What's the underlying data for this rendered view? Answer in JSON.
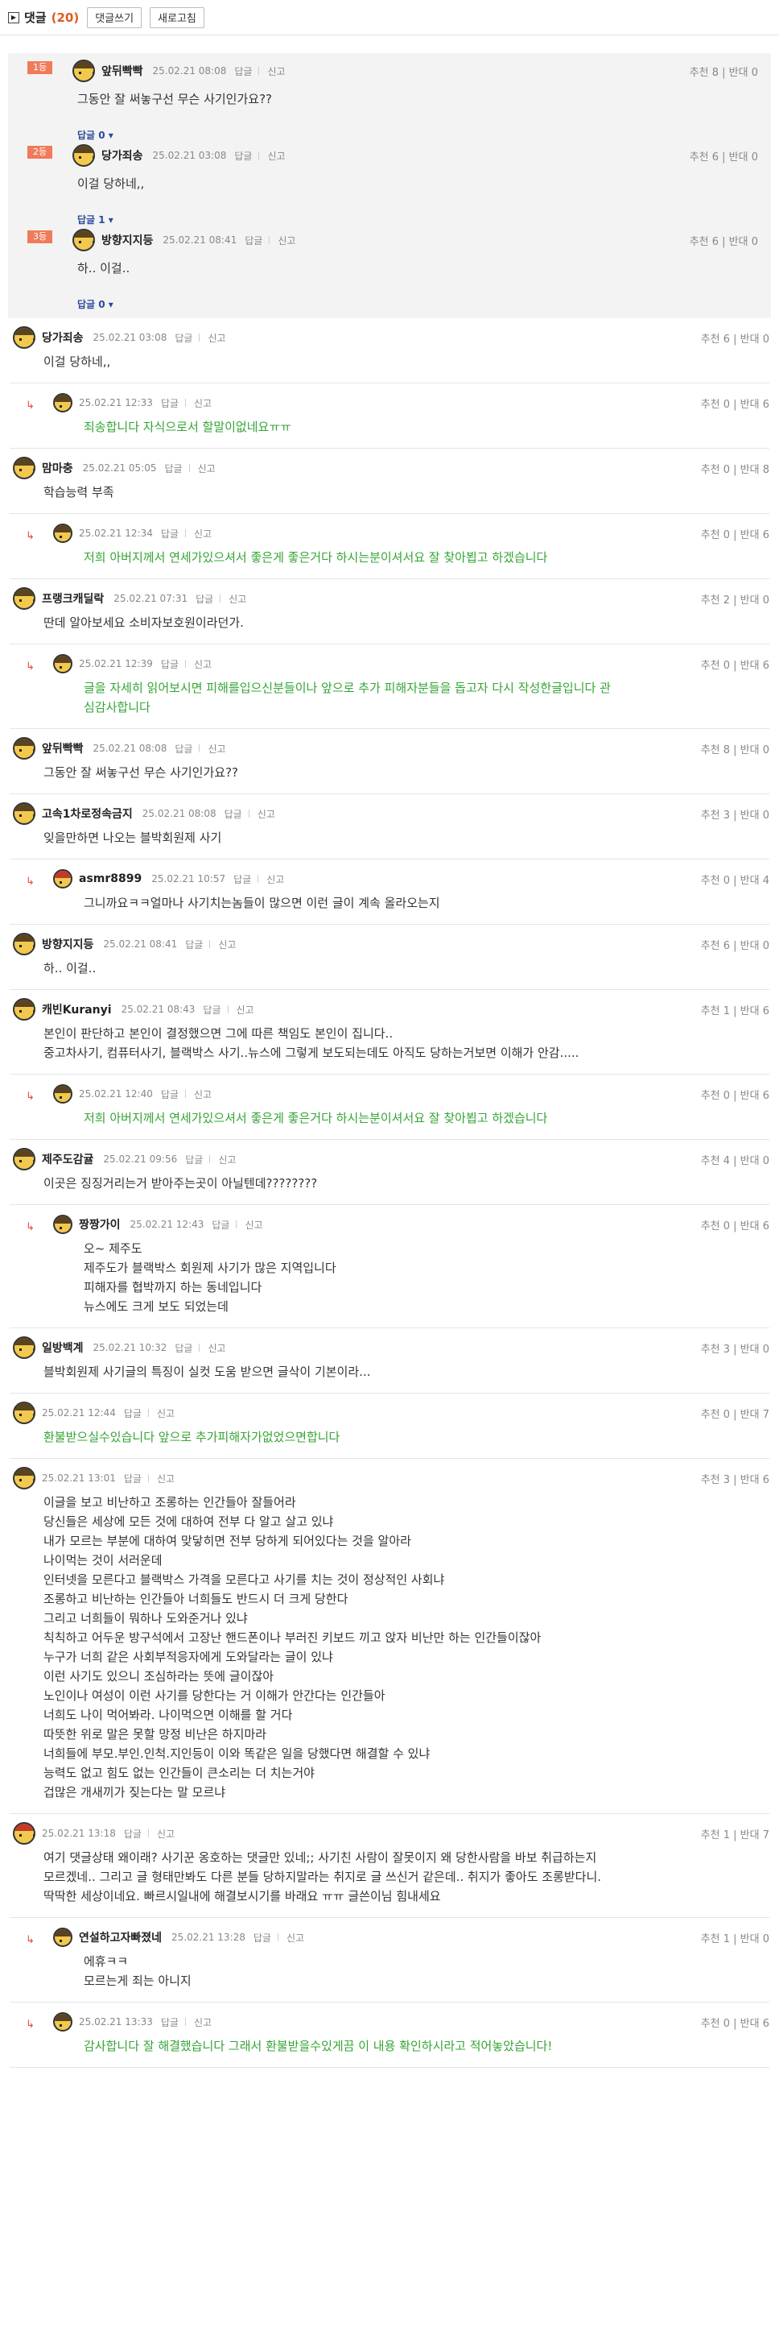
{
  "header": {
    "title": "댓글",
    "count": "(20)",
    "write_label": "댓글쓰기",
    "refresh_label": "새로고침"
  },
  "labels": {
    "reply": "답글",
    "report": "신고",
    "up": "추천",
    "down": "반대"
  },
  "best": [
    {
      "rank": "1등",
      "nick": "앞뒤빡빡",
      "date": "25.02.21 08:08",
      "text": "그동안 잘 써놓구선 무슨 사기인가요??",
      "up": "8",
      "down": "0",
      "reply_toggle": "답글 0 ▾"
    },
    {
      "rank": "2등",
      "nick": "당가죄송",
      "date": "25.02.21 03:08",
      "text": "이걸 당하네,,",
      "up": "6",
      "down": "0",
      "reply_toggle": "답글 1 ▾"
    },
    {
      "rank": "3등",
      "nick": "방향지지등",
      "date": "25.02.21 08:41",
      "text": "하.. 이걸..",
      "up": "6",
      "down": "0",
      "reply_toggle": "답글 0 ▾"
    }
  ],
  "comments": [
    {
      "reply": false,
      "nick": "당가죄송",
      "date": "25.02.21 03:08",
      "up": "6",
      "down": "0",
      "lines": [
        "이걸 당하네,,"
      ]
    },
    {
      "reply": true,
      "nick": "",
      "date": "25.02.21 12:33",
      "up": "0",
      "down": "6",
      "green": true,
      "lines": [
        "죄송합니다 자식으로서 할말이없네요ㅠㅠ"
      ]
    },
    {
      "reply": false,
      "nick": "맘마충",
      "date": "25.02.21 05:05",
      "up": "0",
      "down": "8",
      "lines": [
        "학습능력 부족"
      ]
    },
    {
      "reply": true,
      "nick": "",
      "date": "25.02.21 12:34",
      "up": "0",
      "down": "6",
      "green": true,
      "lines": [
        "저희 아버지께서 연세가있으셔서 좋은게 좋은거다 하시는분이셔서요 잘 찾아뵙고 하겠습니다"
      ]
    },
    {
      "reply": false,
      "nick": "프랭크캐딜락",
      "date": "25.02.21 07:31",
      "up": "2",
      "down": "0",
      "lines": [
        "딴데 알아보세요 소비자보호원이라던가."
      ]
    },
    {
      "reply": true,
      "nick": "",
      "date": "25.02.21 12:39",
      "up": "0",
      "down": "6",
      "green": true,
      "lines": [
        "글을 자세히 읽어보시면 피해를입으신분들이나 앞으로 추가 피해자분들을 돕고자 다시 작성한글입니다 관",
        "심감사합니다"
      ]
    },
    {
      "reply": false,
      "nick": "앞뒤빡빡",
      "date": "25.02.21 08:08",
      "up": "8",
      "down": "0",
      "lines": [
        "그동안 잘 써놓구선 무슨 사기인가요??"
      ]
    },
    {
      "reply": false,
      "nick": "고속1차로정속금지",
      "date": "25.02.21 08:08",
      "up": "3",
      "down": "0",
      "lines": [
        "잊을만하면 나오는 블박회원제 사기"
      ]
    },
    {
      "reply": true,
      "nick": "asmr8899",
      "date": "25.02.21 10:57",
      "up": "0",
      "down": "4",
      "avatar": "red",
      "lines": [
        "그니까요ㅋㅋ얼마나 사기치는놈들이 많으면 이런 글이 계속 올라오는지"
      ]
    },
    {
      "reply": false,
      "nick": "방향지지등",
      "date": "25.02.21 08:41",
      "up": "6",
      "down": "0",
      "lines": [
        "하.. 이걸.."
      ]
    },
    {
      "reply": false,
      "nick": "캐빈Kuranyi",
      "date": "25.02.21 08:43",
      "up": "1",
      "down": "6",
      "lines": [
        "본인이 판단하고 본인이 결정했으면 그에 따른 책임도 본인이 집니다..",
        "중고차사기, 컴퓨터사기, 블랙박스 사기..뉴스에 그렇게 보도되는데도 아직도 당하는거보면 이해가 안감....."
      ]
    },
    {
      "reply": true,
      "nick": "",
      "date": "25.02.21 12:40",
      "up": "0",
      "down": "6",
      "green": true,
      "lines": [
        "저희 아버지께서 연세가있으셔서 좋은게 좋은거다 하시는분이셔서요 잘 찾아뵙고 하겠습니다"
      ]
    },
    {
      "reply": false,
      "nick": "제주도감귤",
      "date": "25.02.21 09:56",
      "up": "4",
      "down": "0",
      "lines": [
        "이곳은 징징거리는거 받아주는곳이 아닐텐데????????"
      ]
    },
    {
      "reply": true,
      "nick": "짱짱가이",
      "date": "25.02.21 12:43",
      "up": "0",
      "down": "6",
      "lines": [
        "오~ 제주도",
        "제주도가 블랙박스 회원제 사기가 많은 지역입니다",
        "피해자를 협박까지 하는 동네입니다",
        "뉴스에도 크게 보도 되었는데"
      ]
    },
    {
      "reply": false,
      "nick": "일방백계",
      "date": "25.02.21 10:32",
      "up": "3",
      "down": "0",
      "lines": [
        "블박회원제 사기글의 특징이 실컷 도움 받으면 글삭이 기본이라..."
      ]
    },
    {
      "reply": false,
      "nick": "",
      "date": "25.02.21 12:44",
      "up": "0",
      "down": "7",
      "green": true,
      "lines": [
        "환불받으실수있습니다 앞으로 추가피해자가없었으면합니다"
      ]
    },
    {
      "reply": false,
      "nick": "",
      "date": "25.02.21 13:01",
      "up": "3",
      "down": "6",
      "lines": [
        "이글을 보고 비난하고 조롱하는 인간들아 잘들어라",
        "당신들은 세상에 모든 것에 대하여 전부 다 알고 살고 있냐",
        "내가 모르는 부분에 대하여 맞닿히면 전부 당하게 되어있다는 것을 알아라",
        "나이먹는 것이 서러운데",
        "인터넷을 모른다고 블랙박스 가격을 모른다고 사기를 치는 것이 정상적인 사회냐",
        "조롱하고 비난하는 인간들아 너희들도 반드시 더 크게 당한다",
        "그리고 너희들이 뭐하나 도와준거나 있냐",
        "칙칙하고 어두운 방구석에서 고장난 핸드폰이나 부러진 키보드 끼고 앉자 비난만 하는 인간들이잖아",
        "누구가 너희 같은 사회부적응자에게 도와달라는 글이 있냐",
        "이런 사기도 있으니 조심하라는 뜻에 글이잖아",
        "노인이나 여성이 이런 사기를 당한다는 거 이해가 안간다는 인간들아",
        "너희도 나이 먹어봐라. 나이먹으면 이해를 할 거다",
        "따뜻한 위로 말은 못할 망정 비난은 하지마라",
        "너희들에 부모.부인.인척.지인등이 이와 똑같은 일을 당했다면 해결할 수 있냐",
        "능력도 없고 힘도 없는 인간들이 큰소리는 더 치는거야",
        "겁많은 개새끼가 짖는다는 말 모르냐"
      ]
    },
    {
      "reply": false,
      "nick": "",
      "date": "25.02.21 13:18",
      "up": "1",
      "down": "7",
      "avatar": "red",
      "lines": [
        "여기 댓글상태 왜이래? 사기꾼 옹호하는 댓글만 있네;; 사기친 사람이 잘못이지 왜 당한사람을 바보 취급하는지",
        "모르겠네.. 그리고 글 형태만봐도 다른 분들 당하지말라는 취지로 글 쓰신거 같은데.. 취지가 좋아도 조롱받다니.",
        "딱딱한 세상이네요. 빠르시일내에 해결보시기를 바래요 ㅠㅠ 글쓴이님 힘내세요"
      ]
    },
    {
      "reply": true,
      "nick": "연설하고자빠졌네",
      "date": "25.02.21 13:28",
      "up": "1",
      "down": "0",
      "lines": [
        "에휴ㅋㅋ",
        "모르는게 죄는 아니지"
      ]
    },
    {
      "reply": true,
      "nick": "",
      "date": "25.02.21 13:33",
      "up": "0",
      "down": "6",
      "green": true,
      "lines": [
        "감사합니다 잘 해결했습니다 그래서 환불받을수있게끔 이 내용 확인하시라고 적어놓았습니다!"
      ]
    }
  ]
}
